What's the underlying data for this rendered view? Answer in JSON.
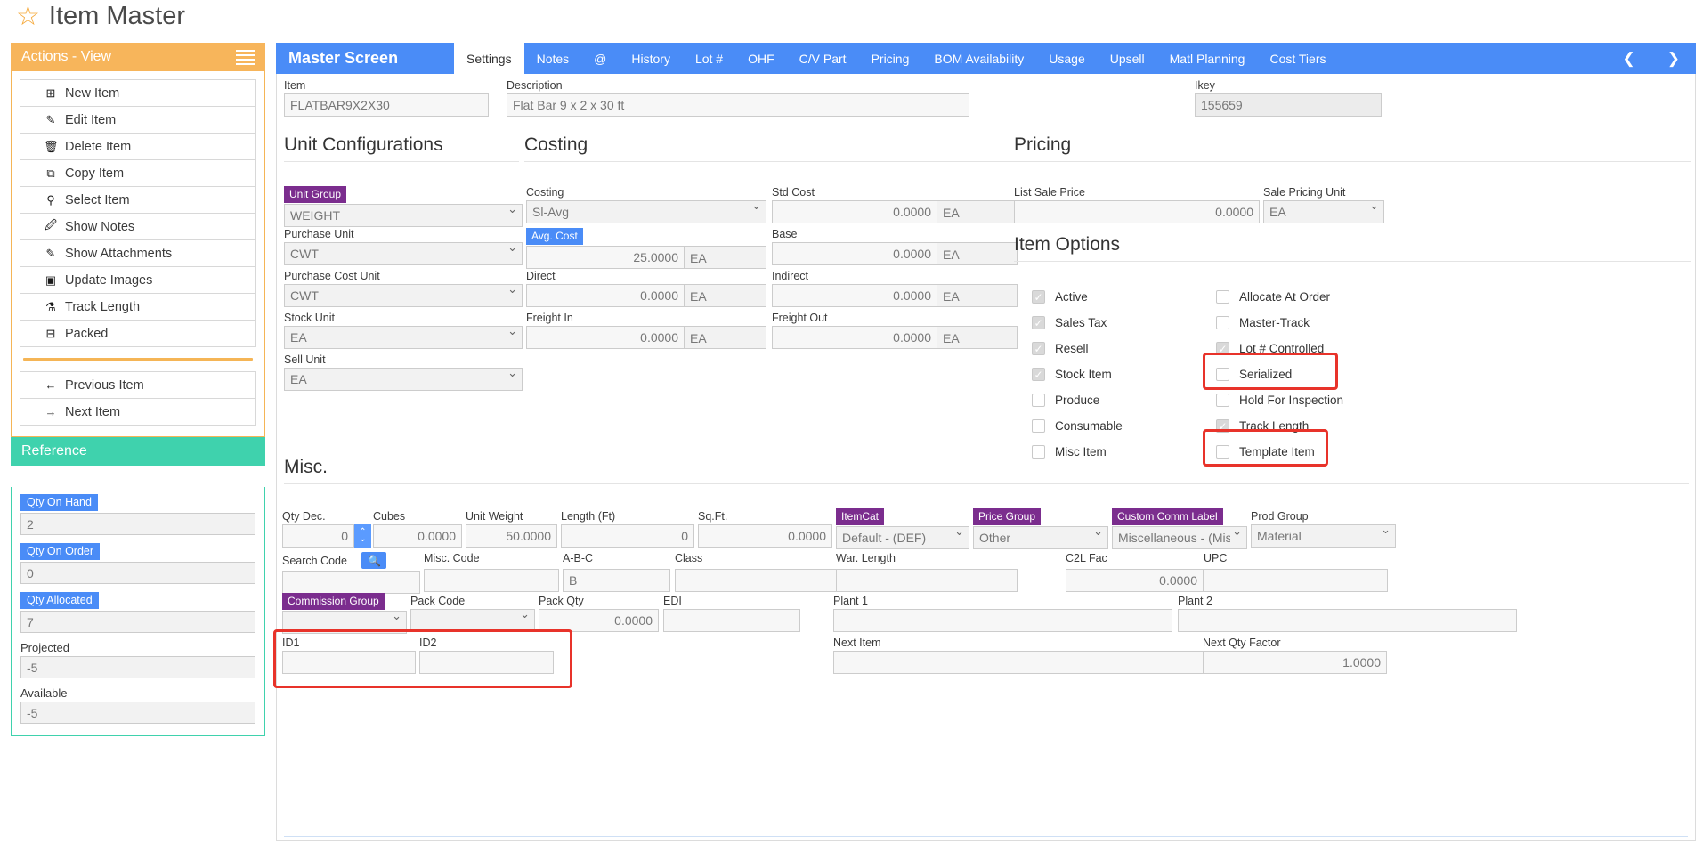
{
  "page": {
    "title": "Item Master",
    "star_icon": "star-icon"
  },
  "actions_panel": {
    "header": "Actions - View",
    "menu_icon": "hamburger-icon",
    "items": [
      {
        "label": "New Item",
        "icon": "plus-square-icon"
      },
      {
        "label": "Edit Item",
        "icon": "pencil-icon"
      },
      {
        "label": "Delete Item",
        "icon": "trash-icon"
      },
      {
        "label": "Copy Item",
        "icon": "copy-icon"
      },
      {
        "label": "Select Item",
        "icon": "pin-icon"
      },
      {
        "label": "Show Notes",
        "icon": "edit-note-icon"
      },
      {
        "label": "Show Attachments",
        "icon": "paperclip-icon"
      },
      {
        "label": "Update Images",
        "icon": "camera-icon"
      },
      {
        "label": "Track Length",
        "icon": "flask-icon"
      },
      {
        "label": "Packed",
        "icon": "minus-square-icon"
      }
    ],
    "nav": [
      {
        "label": "Previous Item",
        "icon": "arrow-left-icon"
      },
      {
        "label": "Next Item",
        "icon": "arrow-right-icon"
      }
    ]
  },
  "reference_panel": {
    "header": "Reference",
    "fields": [
      {
        "label": "Qty On Hand",
        "value": "2",
        "style": "tag"
      },
      {
        "label": "Qty On Order",
        "value": "0",
        "style": "tag"
      },
      {
        "label": "Qty Allocated",
        "value": "7",
        "style": "tag"
      },
      {
        "label": "Projected",
        "value": "-5",
        "style": "plain"
      },
      {
        "label": "Available",
        "value": "-5",
        "style": "plain"
      }
    ]
  },
  "main": {
    "screen_title": "Master Screen",
    "tabs": [
      {
        "label": "Settings",
        "active": true
      },
      {
        "label": "Notes",
        "active": false
      },
      {
        "label": "@",
        "active": false
      },
      {
        "label": "History",
        "active": false
      },
      {
        "label": "Lot #",
        "active": false
      },
      {
        "label": "OHF",
        "active": false
      },
      {
        "label": "C/V Part",
        "active": false
      },
      {
        "label": "Pricing",
        "active": false
      },
      {
        "label": "BOM Availability",
        "active": false
      },
      {
        "label": "Usage",
        "active": false
      },
      {
        "label": "Upsell",
        "active": false
      },
      {
        "label": "Matl Planning",
        "active": false
      },
      {
        "label": "Cost Tiers",
        "active": false
      }
    ],
    "prev_arrow": "❮",
    "next_arrow": "❯",
    "header_fields": {
      "item_label": "Item",
      "item_value": "FLATBAR9X2X30",
      "description_label": "Description",
      "description_value": "Flat Bar 9 x 2 x 30 ft",
      "ikey_label": "Ikey",
      "ikey_value": "155659"
    },
    "sections": {
      "unit_configurations": "Unit Configurations",
      "costing": "Costing",
      "pricing": "Pricing",
      "item_options": "Item Options",
      "misc": "Misc."
    },
    "unit_config": {
      "unit_group_label": "Unit Group",
      "unit_group_value": "WEIGHT",
      "purchase_unit_label": "Purchase Unit",
      "purchase_unit_value": "CWT",
      "purchase_cost_unit_label": "Purchase Cost Unit",
      "purchase_cost_unit_value": "CWT",
      "stock_unit_label": "Stock Unit",
      "stock_unit_value": "EA",
      "sell_unit_label": "Sell Unit",
      "sell_unit_value": "EA"
    },
    "costing": {
      "costing_label": "Costing",
      "costing_value": "Sl-Avg",
      "avg_cost_label": "Avg. Cost",
      "avg_cost_value": "25.0000",
      "avg_cost_unit": "EA",
      "direct_label": "Direct",
      "direct_value": "0.0000",
      "direct_unit": "EA",
      "freight_in_label": "Freight In",
      "freight_in_value": "0.0000",
      "freight_in_unit": "EA",
      "std_cost_label": "Std Cost",
      "std_cost_value": "0.0000",
      "std_cost_unit": "EA",
      "base_label": "Base",
      "base_value": "0.0000",
      "base_unit": "EA",
      "indirect_label": "Indirect",
      "indirect_value": "0.0000",
      "indirect_unit": "EA",
      "freight_out_label": "Freight Out",
      "freight_out_value": "0.0000",
      "freight_out_unit": "EA"
    },
    "pricing": {
      "list_sale_price_label": "List Sale Price",
      "list_sale_price_value": "0.0000",
      "sale_pricing_unit_label": "Sale Pricing Unit",
      "sale_pricing_unit_value": "EA"
    },
    "item_options_left": [
      {
        "label": "Active",
        "checked": true
      },
      {
        "label": "Sales Tax",
        "checked": true
      },
      {
        "label": "Resell",
        "checked": true
      },
      {
        "label": "Stock Item",
        "checked": true
      },
      {
        "label": "Produce",
        "checked": false
      },
      {
        "label": "Consumable",
        "checked": false
      },
      {
        "label": "Misc Item",
        "checked": false
      }
    ],
    "item_options_right": [
      {
        "label": "Allocate At Order",
        "checked": false,
        "highlighted": false
      },
      {
        "label": "Master-Track",
        "checked": false,
        "highlighted": false
      },
      {
        "label": "Lot # Controlled",
        "checked": true,
        "highlighted": true
      },
      {
        "label": "Serialized",
        "checked": false,
        "highlighted": false
      },
      {
        "label": "Hold For Inspection",
        "checked": false,
        "highlighted": false
      },
      {
        "label": "Track Length",
        "checked": true,
        "highlighted": true
      },
      {
        "label": "Template Item",
        "checked": false,
        "highlighted": false
      }
    ],
    "misc": {
      "qty_dec_label": "Qty Dec.",
      "qty_dec_value": "0",
      "cubes_label": "Cubes",
      "cubes_value": "0.0000",
      "unit_weight_label": "Unit Weight",
      "unit_weight_value": "50.0000",
      "length_ft_label": "Length (Ft)",
      "length_ft_value": "0",
      "sqft_label": "Sq.Ft.",
      "sqft_value": "0.0000",
      "itemcat_label": "ItemCat",
      "itemcat_value": "Default - (DEF)",
      "price_group_label": "Price Group",
      "price_group_value": "Other",
      "custom_comm_label_label": "Custom Comm Label",
      "custom_comm_label_value": "Miscellaneous - (Misc)",
      "prod_group_label": "Prod Group",
      "prod_group_value": "Material",
      "search_code_label": "Search Code",
      "search_code_value": "",
      "search_icon": "magnifier-icon",
      "misc_code_label": "Misc. Code",
      "misc_code_value": "",
      "abc_label": "A-B-C",
      "abc_value": "B",
      "class_label": "Class",
      "class_value": "",
      "war_length_label": "War. Length",
      "war_length_value": "",
      "c2l_fac_label": "C2L Fac",
      "c2l_fac_value": "0.0000",
      "upc_label": "UPC",
      "upc_value": "",
      "commission_group_label": "Commission Group",
      "commission_group_value": "",
      "pack_code_label": "Pack Code",
      "pack_code_value": "",
      "pack_qty_label": "Pack Qty",
      "pack_qty_value": "0.0000",
      "edi_label": "EDI",
      "edi_value": "",
      "plant1_label": "Plant 1",
      "plant1_value": "",
      "plant2_label": "Plant 2",
      "plant2_value": "",
      "id1_label": "ID1",
      "id1_value": "",
      "id2_label": "ID2",
      "id2_value": "",
      "next_item_label": "Next Item",
      "next_item_value": "",
      "next_qty_factor_label": "Next Qty Factor",
      "next_qty_factor_value": "1.0000"
    }
  },
  "colors": {
    "accent_blue": "#4a8cf7",
    "orange": "#f7b55b",
    "teal": "#3fd2ad",
    "purple": "#7b2d8e",
    "highlight_red": "#e8332a"
  }
}
